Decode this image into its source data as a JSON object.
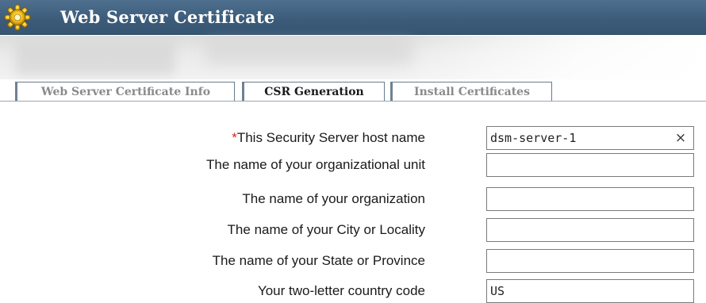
{
  "window": {
    "title": "Web Server Certificate",
    "icon": "gear-icon"
  },
  "tabs": [
    {
      "label": "Web Server Certificate Info",
      "state": "inactive"
    },
    {
      "label": "CSR Generation",
      "state": "active"
    },
    {
      "label": "Install Certificates",
      "state": "inactive"
    }
  ],
  "form": {
    "fields": [
      {
        "label": "This Security Server host name",
        "required": true,
        "required_marker": "*",
        "value": "dsm-server-1",
        "clear_icon": "×"
      },
      {
        "label": "The name of your organizational unit",
        "value": ""
      },
      {
        "label": "The name of your organization",
        "value": ""
      },
      {
        "label": "The name of your City or Locality",
        "value": ""
      },
      {
        "label": "The name of your State or Province",
        "value": ""
      },
      {
        "label": "Your two-letter country code",
        "value": "US"
      }
    ]
  },
  "colors": {
    "titlebar": "#3b5b79",
    "required": "#e22020",
    "active_tab_text": "#1a1a1a",
    "inactive_tab_text": "#8a8a8a"
  }
}
